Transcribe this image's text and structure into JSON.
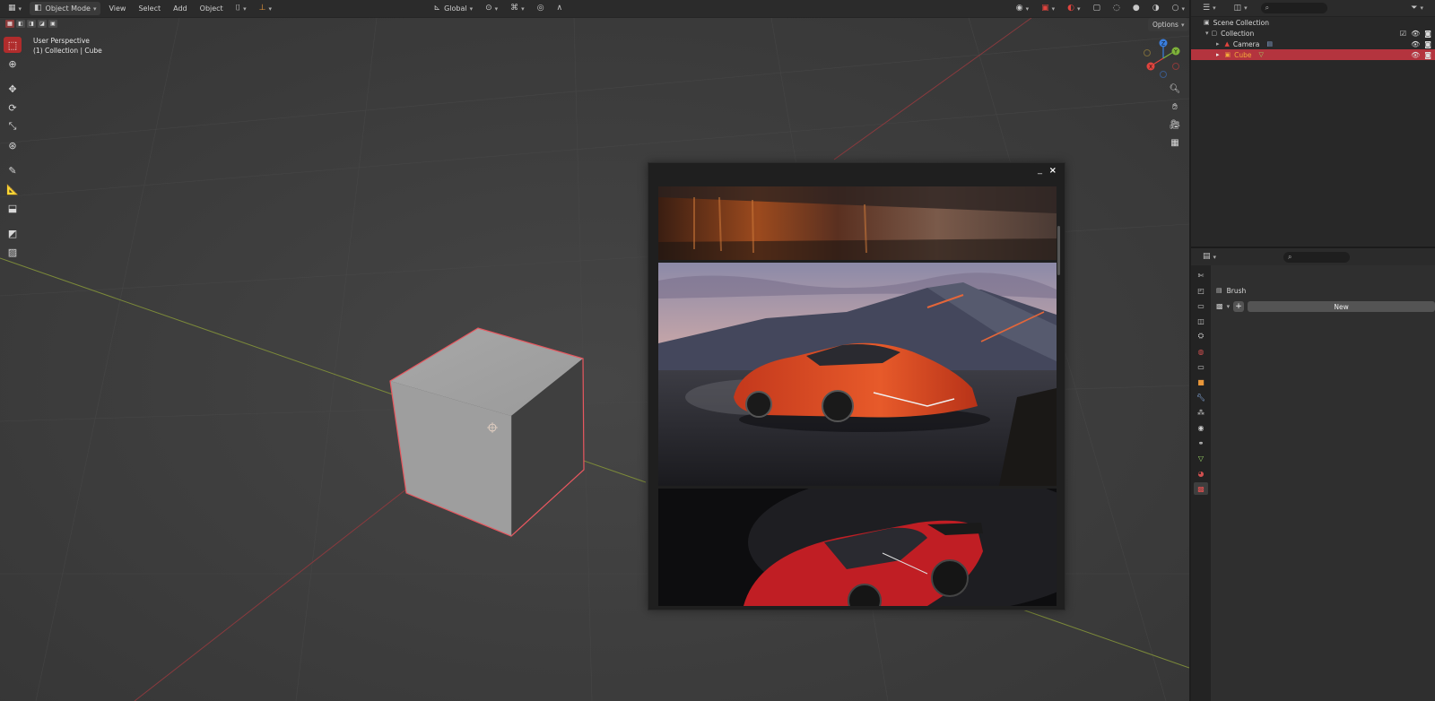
{
  "header": {
    "mode_label": "Object Mode",
    "menu": [
      "View",
      "Select",
      "Add",
      "Object"
    ],
    "orientation_label": "Global",
    "options_label": "Options"
  },
  "viewport": {
    "perspective_label": "User Perspective",
    "context_label": "(1) Collection | Cube"
  },
  "gizmo": {
    "x": "X",
    "y": "Y",
    "z": "Z"
  },
  "image_window": {
    "minimize_label": "_",
    "close_label": "×"
  },
  "outliner": {
    "items": [
      {
        "label": "Scene Collection"
      },
      {
        "label": "Collection"
      },
      {
        "label": "Camera"
      },
      {
        "label": "Cube"
      }
    ]
  },
  "properties": {
    "brush_label": "Brush",
    "new_label": "New",
    "plus_label": "+"
  },
  "colors": {
    "accent": "#b4343e",
    "selected_text": "#f3a93a",
    "cube_outline": "#e8575f",
    "gizmo_x": "#e0443e",
    "gizmo_y": "#7fb33a",
    "gizmo_z": "#3a7fe0"
  }
}
